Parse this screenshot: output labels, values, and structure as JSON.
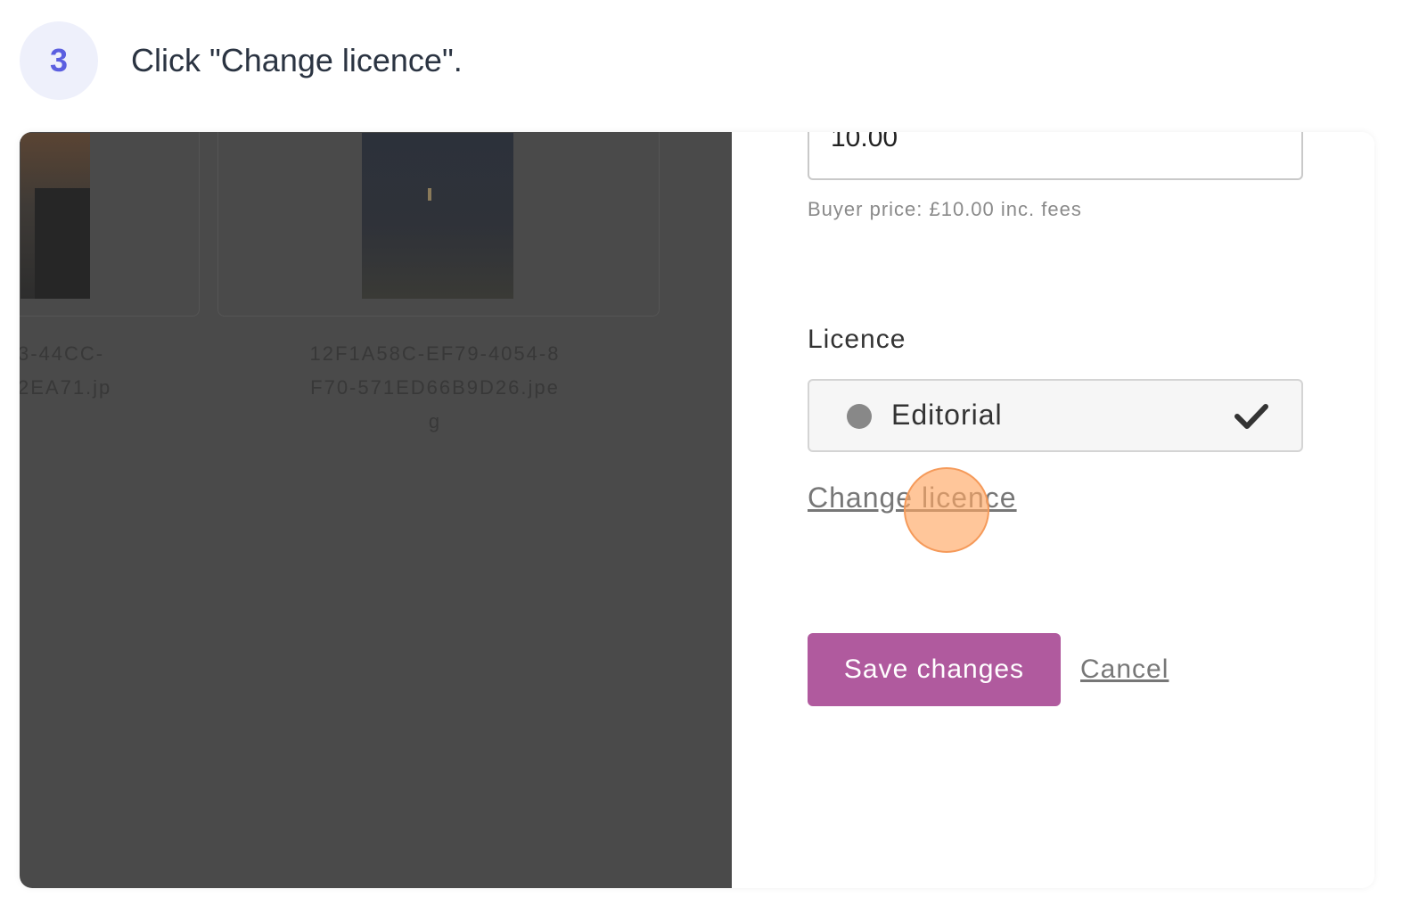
{
  "step": {
    "number": "3",
    "instruction": "Click \"Change licence\"."
  },
  "background": {
    "files": [
      {
        "name": "3-44CC-\n2EA71.jp"
      },
      {
        "name": "12F1A58C-EF79-4054-8\nF70-571ED66B9D26.jpe\ng"
      }
    ]
  },
  "form": {
    "price_value": "10.00",
    "buyer_price": "Buyer price: £10.00 inc. fees",
    "licence_label": "Licence",
    "licence_selected": "Editorial",
    "change_licence": "Change licence",
    "save_label": "Save changes",
    "cancel_label": "Cancel"
  },
  "colors": {
    "accent": "#b05a9e",
    "step_badge": "#5b5fe0",
    "click_highlight": "#f59a5a"
  },
  "icons": {
    "selected_marker": "circle-dot-icon",
    "check": "check-icon"
  }
}
